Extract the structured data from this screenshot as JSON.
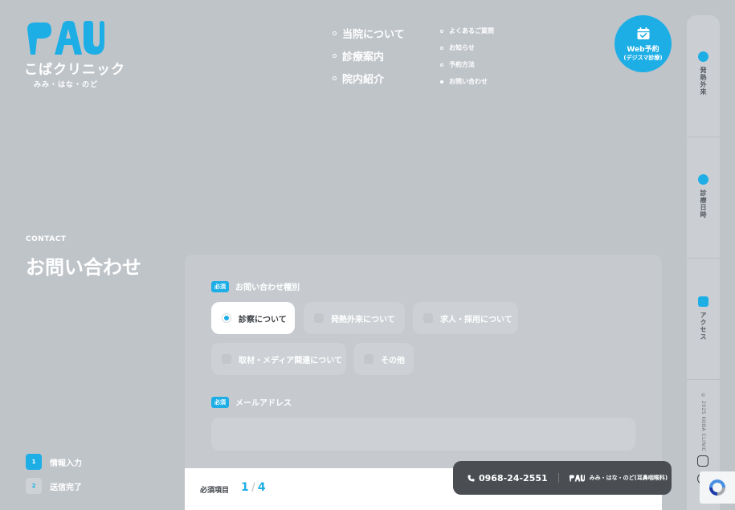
{
  "brand": {
    "name": "こばクリニック",
    "subtitle": "みみ・はな・のど",
    "accent": "#1eaee6"
  },
  "nav": {
    "main": [
      "当院について",
      "診療案内",
      "院内紹介"
    ],
    "sub": [
      "よくあるご質問",
      "お知らせ",
      "予約方法",
      "お問い合わせ"
    ],
    "active_sub": "お問い合わせ"
  },
  "web_reserve": {
    "label": "Web予約",
    "sublabel": "(デジスマ診療)",
    "icon": "calendar-check-icon"
  },
  "side_rail": {
    "fever": "発熱外来",
    "hours": "診療日時",
    "access": "アクセス",
    "copyright": "© 2025 KOBA CLINIC"
  },
  "page": {
    "eyebrow": "CONTACT",
    "title": "お問い合わせ"
  },
  "steps": [
    {
      "num": "1",
      "label": "情報入力",
      "state": "active"
    },
    {
      "num": "2",
      "label": "送信完了",
      "state": "inactive"
    }
  ],
  "form": {
    "required_badge": "必須",
    "inquiry_type_label": "お問い合わせ種別",
    "options": [
      "診察について",
      "発熱外来について",
      "求人・採用について",
      "取材・メディア関連について",
      "その他"
    ],
    "selected_option": "診察について",
    "email_label": "メールアドレス",
    "email_value": "",
    "required_items_label": "必須項目",
    "progress_current": "1",
    "progress_total": "4"
  },
  "phone_bar": {
    "number": "0968-24-2551",
    "clinic": "みみ・はな・のど(耳鼻咽喉科)",
    "icon": "phone-icon"
  }
}
